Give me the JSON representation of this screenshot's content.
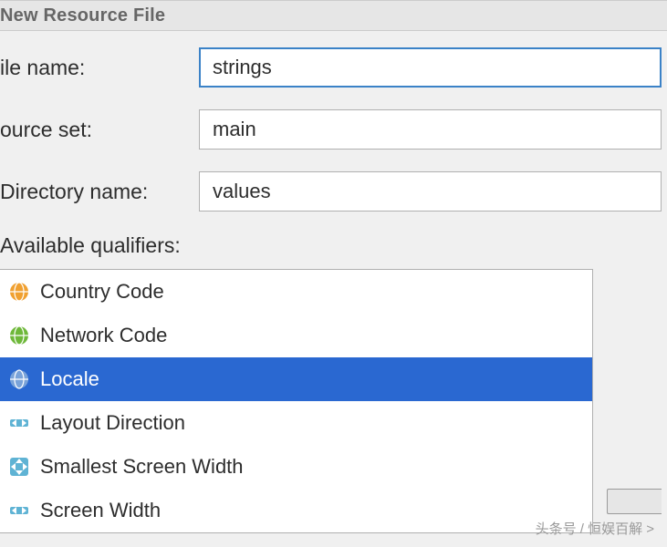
{
  "dialog": {
    "title": "New Resource File"
  },
  "fields": {
    "file_name": {
      "label": "ile name:",
      "value": "strings"
    },
    "source_set": {
      "label": "ource set:",
      "value": "main"
    },
    "directory_name": {
      "label": "Directory name:",
      "value": "values"
    }
  },
  "qualifiers": {
    "section_label": "Available qualifiers:",
    "items": [
      {
        "label": "Country Code",
        "icon": "globe-orange",
        "selected": false
      },
      {
        "label": "Network Code",
        "icon": "globe-green",
        "selected": false
      },
      {
        "label": "Locale",
        "icon": "globe-blue",
        "selected": true
      },
      {
        "label": "Layout Direction",
        "icon": "arrow-bi",
        "selected": false
      },
      {
        "label": "Smallest Screen Width",
        "icon": "arrows-all",
        "selected": false
      },
      {
        "label": "Screen Width",
        "icon": "arrow-bi",
        "selected": false
      }
    ]
  },
  "watermark": "头条号 / 恒娱百解 >"
}
